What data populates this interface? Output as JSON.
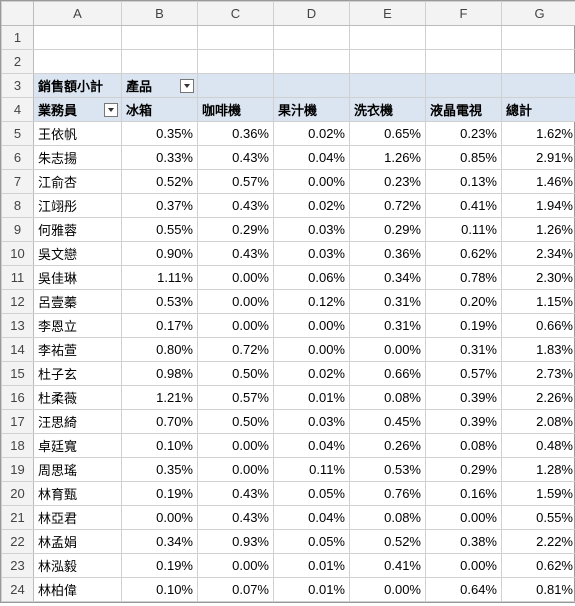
{
  "columns": [
    "A",
    "B",
    "C",
    "D",
    "E",
    "F",
    "G"
  ],
  "pivot": {
    "valueLabel": "銷售額小計",
    "colFieldLabel": "產品",
    "rowFieldLabel": "業務員",
    "productHeaders": [
      "冰箱",
      "咖啡機",
      "果汁機",
      "洗衣機",
      "液晶電視",
      "總計"
    ]
  },
  "rows": [
    {
      "n": 5,
      "name": "王依帆",
      "v": [
        "0.35%",
        "0.36%",
        "0.02%",
        "0.65%",
        "0.23%",
        "1.62%"
      ]
    },
    {
      "n": 6,
      "name": "朱志揚",
      "v": [
        "0.33%",
        "0.43%",
        "0.04%",
        "1.26%",
        "0.85%",
        "2.91%"
      ]
    },
    {
      "n": 7,
      "name": "江俞杏",
      "v": [
        "0.52%",
        "0.57%",
        "0.00%",
        "0.23%",
        "0.13%",
        "1.46%"
      ]
    },
    {
      "n": 8,
      "name": "江翊彤",
      "v": [
        "0.37%",
        "0.43%",
        "0.02%",
        "0.72%",
        "0.41%",
        "1.94%"
      ]
    },
    {
      "n": 9,
      "name": "何雅蓉",
      "v": [
        "0.55%",
        "0.29%",
        "0.03%",
        "0.29%",
        "0.11%",
        "1.26%"
      ]
    },
    {
      "n": 10,
      "name": "吳文戀",
      "v": [
        "0.90%",
        "0.43%",
        "0.03%",
        "0.36%",
        "0.62%",
        "2.34%"
      ]
    },
    {
      "n": 11,
      "name": "吳佳琳",
      "v": [
        "1.11%",
        "0.00%",
        "0.06%",
        "0.34%",
        "0.78%",
        "2.30%"
      ]
    },
    {
      "n": 12,
      "name": "呂壹蓁",
      "v": [
        "0.53%",
        "0.00%",
        "0.12%",
        "0.31%",
        "0.20%",
        "1.15%"
      ]
    },
    {
      "n": 13,
      "name": "李恩立",
      "v": [
        "0.17%",
        "0.00%",
        "0.00%",
        "0.31%",
        "0.19%",
        "0.66%"
      ]
    },
    {
      "n": 14,
      "name": "李祐萱",
      "v": [
        "0.80%",
        "0.72%",
        "0.00%",
        "0.00%",
        "0.31%",
        "1.83%"
      ]
    },
    {
      "n": 15,
      "name": "杜子玄",
      "v": [
        "0.98%",
        "0.50%",
        "0.02%",
        "0.66%",
        "0.57%",
        "2.73%"
      ]
    },
    {
      "n": 16,
      "name": "杜柔薇",
      "v": [
        "1.21%",
        "0.57%",
        "0.01%",
        "0.08%",
        "0.39%",
        "2.26%"
      ]
    },
    {
      "n": 17,
      "name": "汪思綺",
      "v": [
        "0.70%",
        "0.50%",
        "0.03%",
        "0.45%",
        "0.39%",
        "2.08%"
      ]
    },
    {
      "n": 18,
      "name": "卓廷寬",
      "v": [
        "0.10%",
        "0.00%",
        "0.04%",
        "0.26%",
        "0.08%",
        "0.48%"
      ]
    },
    {
      "n": 19,
      "name": "周思瑤",
      "v": [
        "0.35%",
        "0.00%",
        "0.11%",
        "0.53%",
        "0.29%",
        "1.28%"
      ]
    },
    {
      "n": 20,
      "name": "林育甄",
      "v": [
        "0.19%",
        "0.43%",
        "0.05%",
        "0.76%",
        "0.16%",
        "1.59%"
      ]
    },
    {
      "n": 21,
      "name": "林亞君",
      "v": [
        "0.00%",
        "0.43%",
        "0.04%",
        "0.08%",
        "0.00%",
        "0.55%"
      ]
    },
    {
      "n": 22,
      "name": "林孟娟",
      "v": [
        "0.34%",
        "0.93%",
        "0.05%",
        "0.52%",
        "0.38%",
        "2.22%"
      ]
    },
    {
      "n": 23,
      "name": "林泓毅",
      "v": [
        "0.19%",
        "0.00%",
        "0.01%",
        "0.41%",
        "0.00%",
        "0.62%"
      ]
    },
    {
      "n": 24,
      "name": "林柏偉",
      "v": [
        "0.10%",
        "0.07%",
        "0.01%",
        "0.00%",
        "0.64%",
        "0.81%"
      ]
    }
  ]
}
